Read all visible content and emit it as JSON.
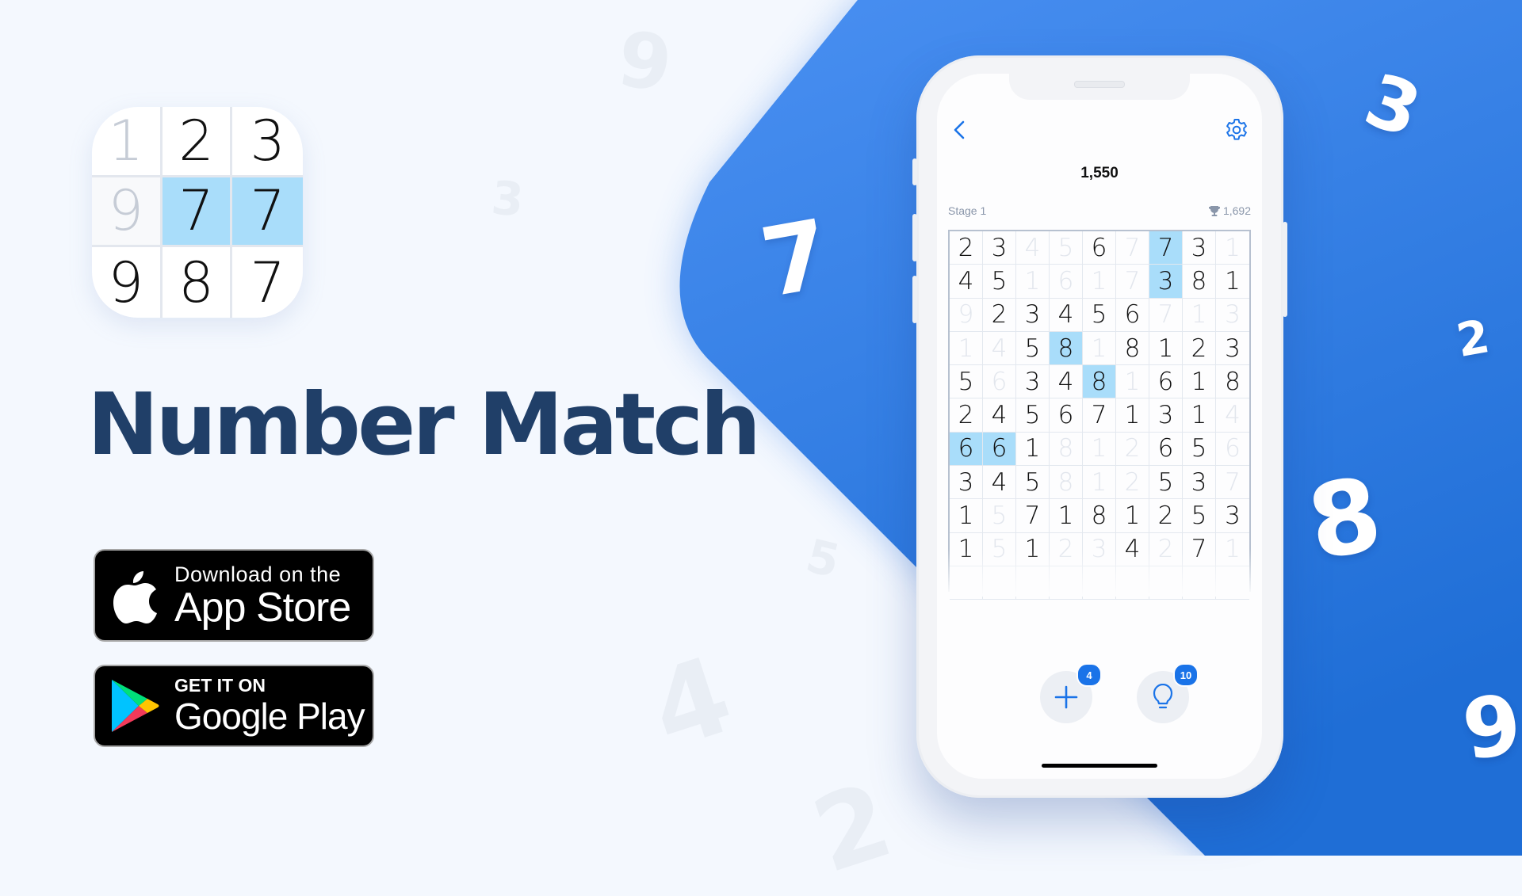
{
  "app_icon": {
    "cells": [
      {
        "value": "1",
        "state": "faded"
      },
      {
        "value": "2",
        "state": "normal"
      },
      {
        "value": "3",
        "state": "normal"
      },
      {
        "value": "9",
        "state": "faded-bg"
      },
      {
        "value": "7",
        "state": "highlighted"
      },
      {
        "value": "7",
        "state": "highlighted"
      },
      {
        "value": "9",
        "state": "normal"
      },
      {
        "value": "8",
        "state": "normal"
      },
      {
        "value": "7",
        "state": "normal"
      }
    ]
  },
  "title": "Number Match",
  "badges": {
    "app_store": {
      "small": "Download on the",
      "big": "App Store",
      "icon": "apple-icon"
    },
    "google_play": {
      "small": "GET IT ON",
      "big": "Google Play",
      "icon": "google-play-icon"
    }
  },
  "background_numbers_faded": [
    "9",
    "3",
    "5",
    "4",
    "2"
  ],
  "background_numbers_white": [
    "7",
    "3",
    "2",
    "8",
    "9"
  ],
  "colors": {
    "accent": "#1a73e8",
    "blue_panel": "#458cf0",
    "title": "#203f68",
    "highlight": "#a9ddfa",
    "background": "#f4f8fe"
  },
  "phone": {
    "score": "1,550",
    "stage_label": "Stage 1",
    "best_score": "1,692",
    "back_icon": "chevron-left-icon",
    "settings_icon": "gear-icon",
    "grid": [
      [
        "2",
        "3",
        "4",
        "5",
        "6",
        "7",
        "7",
        "3",
        "1"
      ],
      [
        "4",
        "5",
        "1",
        "6",
        "1",
        "7",
        "3",
        "8",
        "1"
      ],
      [
        "9",
        "2",
        "3",
        "4",
        "5",
        "6",
        "7",
        "1",
        "3"
      ],
      [
        "1",
        "4",
        "5",
        "8",
        "1",
        "8",
        "1",
        "2",
        "3"
      ],
      [
        "5",
        "6",
        "3",
        "4",
        "8",
        "1",
        "6",
        "1",
        "8"
      ],
      [
        "2",
        "4",
        "5",
        "6",
        "7",
        "1",
        "3",
        "1",
        "4"
      ],
      [
        "6",
        "6",
        "1",
        "8",
        "1",
        "2",
        "6",
        "5",
        "6"
      ],
      [
        "3",
        "4",
        "5",
        "8",
        "1",
        "2",
        "5",
        "3",
        "7"
      ],
      [
        "1",
        "5",
        "7",
        "1",
        "8",
        "1",
        "2",
        "5",
        "3"
      ],
      [
        "1",
        "5",
        "1",
        "2",
        "3",
        "4",
        "2",
        "7",
        "1"
      ]
    ],
    "crossed": [
      [
        0,
        0,
        1,
        1,
        0,
        1,
        0,
        0,
        1
      ],
      [
        0,
        0,
        1,
        1,
        1,
        1,
        0,
        0,
        0
      ],
      [
        1,
        0,
        0,
        0,
        0,
        0,
        1,
        1,
        1
      ],
      [
        1,
        1,
        0,
        0,
        1,
        0,
        0,
        0,
        0
      ],
      [
        0,
        1,
        0,
        0,
        0,
        1,
        0,
        0,
        0
      ],
      [
        0,
        0,
        0,
        0,
        0,
        0,
        0,
        0,
        1
      ],
      [
        0,
        0,
        0,
        1,
        1,
        1,
        0,
        0,
        1
      ],
      [
        0,
        0,
        0,
        1,
        1,
        1,
        0,
        0,
        1
      ],
      [
        0,
        1,
        0,
        0,
        0,
        0,
        0,
        0,
        0
      ],
      [
        0,
        1,
        0,
        1,
        1,
        0,
        1,
        0,
        1
      ]
    ],
    "highlighted": [
      [
        0,
        6
      ],
      [
        1,
        6
      ],
      [
        3,
        3
      ],
      [
        4,
        4
      ],
      [
        6,
        0
      ],
      [
        6,
        1
      ]
    ],
    "actions": [
      {
        "name": "add-numbers",
        "icon": "plus-icon",
        "count": "4"
      },
      {
        "name": "hint",
        "icon": "lightbulb-icon",
        "count": "10"
      }
    ]
  }
}
